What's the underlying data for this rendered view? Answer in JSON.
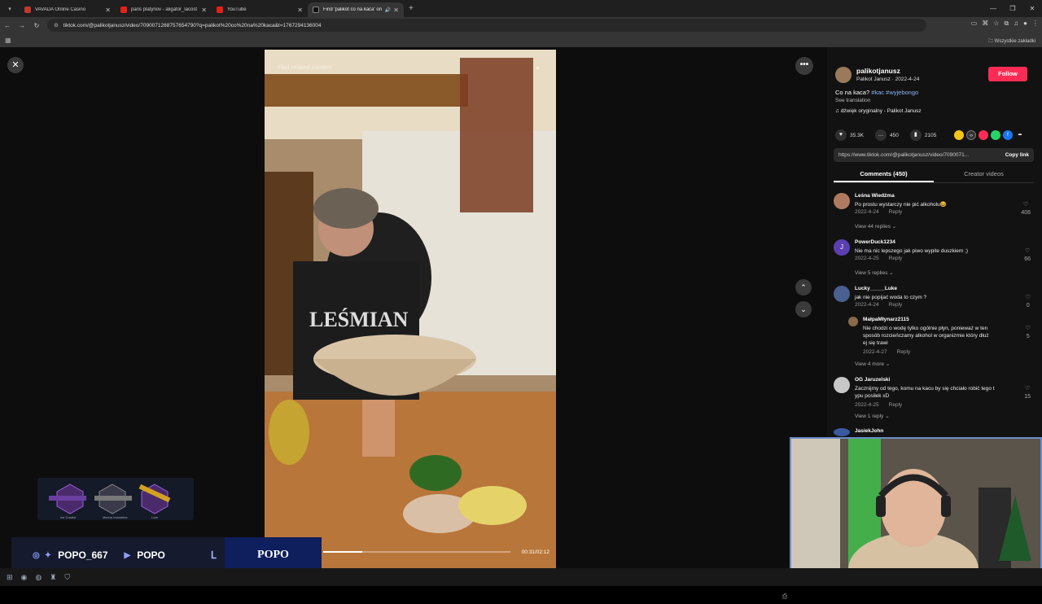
{
  "browser": {
    "tabs": [
      {
        "title": "VAVADA Online Casino",
        "active": false
      },
      {
        "title": "paris platynov - aligator_lacost",
        "active": false
      },
      {
        "title": "YouTube",
        "active": false
      },
      {
        "title": "Find 'palikot co na kaca' on",
        "active": true
      }
    ],
    "url": "tiktok.com/@palikotjanusz/video/7090071268757654790?q=palikot%20co%20na%20kaca&t=1767294136004",
    "bookmarks_all": "Wszystkie zakładki"
  },
  "video": {
    "search_placeholder": "Find related content",
    "time": "00:31/02:12",
    "progress_fraction": 0.21
  },
  "post": {
    "username": "palikotjanusz",
    "subline": "Palikot Janusz · 2022-4-24",
    "follow_label": "Follow",
    "desc_text": "Co na kaca?",
    "desc_tags": "#kac #wyjebongo",
    "see_translation": "See translation",
    "music": "dźwięk oryginalny - Palikot Janusz",
    "likes": "35.3K",
    "comments": "450",
    "saves": "2105",
    "link": "https://www.tiktok.com/@palikotjanusz/video/7090071...",
    "copy_link": "Copy link",
    "tab_comments": "Comments (450)",
    "tab_creator": "Creator videos"
  },
  "comments": [
    {
      "name": "Leśna Wiedźma",
      "text": "Po prostu wystarczy nie pić alkoholu😆",
      "date": "2022-4-24",
      "reply": "Reply",
      "likes": "406",
      "view": "View 44 replies ⌄"
    },
    {
      "name": "PowerDuck1234",
      "text": "Nie ma nic lepszego jak piwo wypite duszkiem ;)",
      "date": "2022-4-25",
      "reply": "Reply",
      "likes": "66",
      "view": "View 5 replies ⌄"
    },
    {
      "name": "Lucky_____Luke",
      "text": "jak nie popijać woda to czym ?",
      "date": "2022-4-24",
      "reply": "Reply",
      "likes": "0",
      "view": ""
    },
    {
      "name": "MałpaMłynarz2115",
      "text_lines": [
        "Nie chodzi o wodę tylko ogólnie płyn, ponieważ w ten",
        "sposób rozcieńczamy alkohol w organizmie który dłuż",
        "ej się trawi"
      ],
      "date": "2022-4-27",
      "reply": "Reply",
      "likes": "5",
      "view": "View 4 more ⌄"
    },
    {
      "name": "OG Jaruzelski",
      "text_lines": [
        "Zacznijmy od tego, komu na kacu by się chciało robić tego t",
        "ypu posiłek xD"
      ],
      "date": "2022-4-25",
      "reply": "Reply",
      "likes": "15",
      "view": "View 1 reply ⌄"
    },
    {
      "name": "JasiekJohn"
    }
  ],
  "overlay": {
    "twitter_handle": "POPO_667",
    "youtube_name": "POPO",
    "brand": "POPO",
    "skins": [
      "Ice Coaled",
      "Mecha Industries",
      "Lore"
    ]
  },
  "colors": {
    "follow": "#fe2c55",
    "tag": "#8ab4f8",
    "webcam_border": "#6a8cc8"
  }
}
